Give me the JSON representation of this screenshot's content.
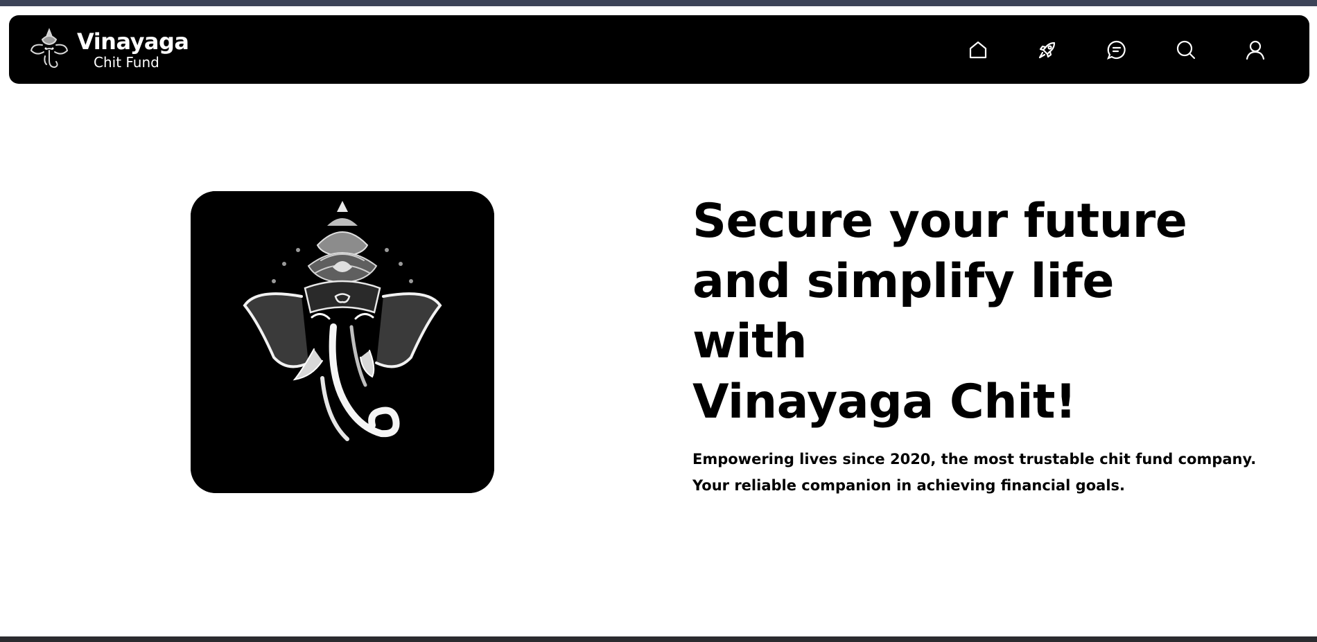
{
  "brand": {
    "title": "Vinayaga",
    "subtitle": "Chit Fund",
    "logo_icon": "ganesha-logo-icon"
  },
  "nav": {
    "icons": [
      "home-icon",
      "rocket-icon",
      "chat-icon",
      "search-icon",
      "user-icon"
    ]
  },
  "hero": {
    "image_icon": "ganesha-illustration-icon",
    "headline_lines": [
      "Secure your future",
      "and simplify life",
      "with",
      "Vinayaga Chit!"
    ],
    "tagline_lines": [
      "Empowering lives since 2020, the most trustable chit fund company.",
      "Your reliable companion in achieving financial goals."
    ]
  },
  "colors": {
    "navbar_bg": "#000000",
    "page_bg": "#ffffff",
    "text": "#000000",
    "top_strip": "#3d4458"
  }
}
